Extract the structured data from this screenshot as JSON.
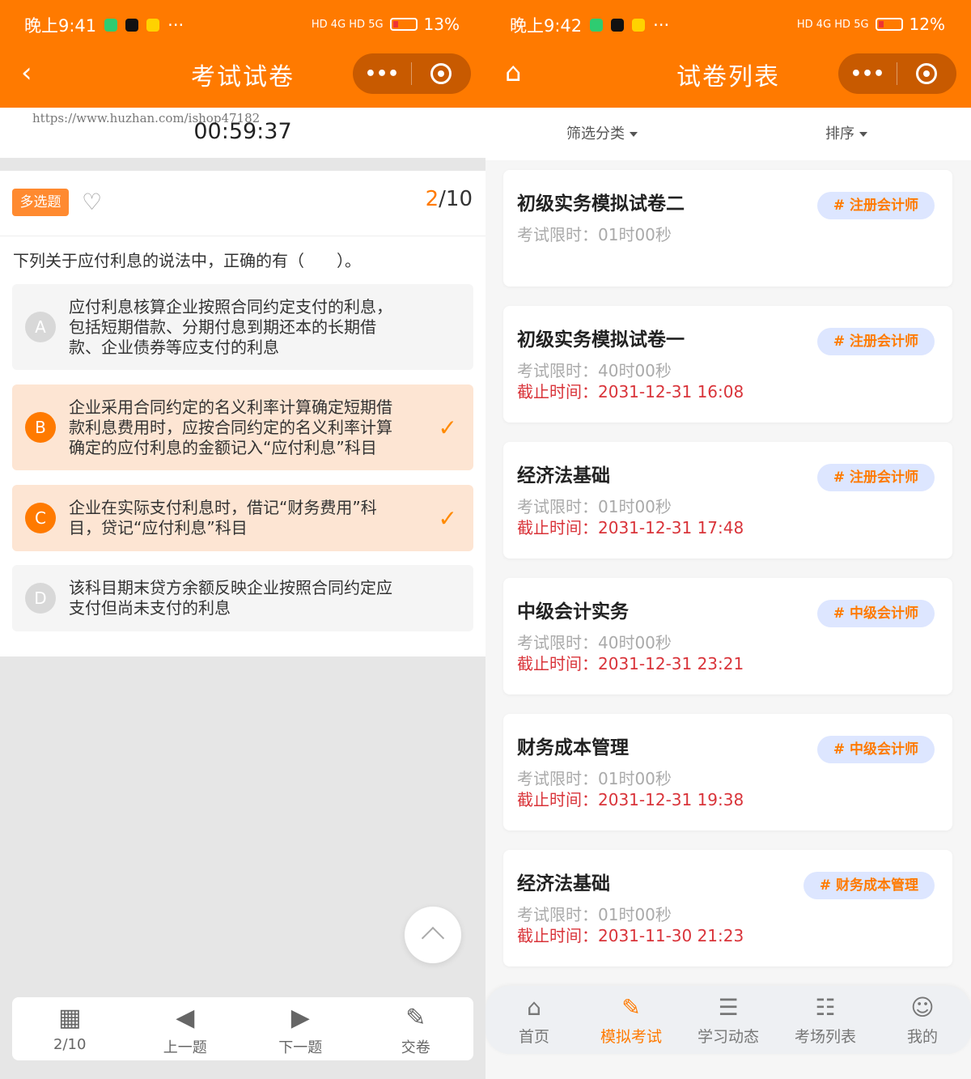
{
  "left": {
    "status": {
      "time": "晚上9:41",
      "signal": "HD 4G HD 5G",
      "battery": "13%"
    },
    "nav": {
      "back_icon": "chevron-left-icon",
      "title": "考试试卷",
      "more_icon": "more-dots-icon",
      "record_icon": "record-icon"
    },
    "watermark": "https://www.huzhan.com/ishop47182",
    "timer": "00:59:37",
    "question": {
      "type_tag": "多选题",
      "progress_current": "2",
      "progress_total": "/10",
      "text": "下列关于应付利息的说法中，正确的有（　　）。",
      "options": [
        {
          "letter": "A",
          "lines": [
            "应付利息核算企业按照合同约定支付的利息，",
            "包括短期借款、分期付息到期还本的长期借",
            "款、企业债券等应支付的利息"
          ],
          "selected": false
        },
        {
          "letter": "B",
          "lines": [
            "企业采用合同约定的名义利率计算确定短期借",
            "款利息费用时，应按合同约定的名义利率计算",
            "确定的应付利息的金额记入“应付利息”科目"
          ],
          "selected": true
        },
        {
          "letter": "C",
          "lines": [
            "企业在实际支付利息时，借记“财务费用”科",
            "目，贷记“应付利息”科目"
          ],
          "selected": true
        },
        {
          "letter": "D",
          "lines": [
            "该科目期末贷方余额反映企业按照合同约定应",
            "支付但尚未支付的利息"
          ],
          "selected": false
        }
      ]
    },
    "bottom": [
      {
        "icon": "grid-icon",
        "label": "2/10"
      },
      {
        "icon": "prev-circle-icon",
        "label": "上一题"
      },
      {
        "icon": "next-circle-icon",
        "label": "下一题"
      },
      {
        "icon": "submit-paper-icon",
        "label": "交卷"
      }
    ]
  },
  "right": {
    "status": {
      "time": "晚上9:42",
      "signal": "HD 4G HD 5G",
      "battery": "12%"
    },
    "nav": {
      "home_icon": "home-icon",
      "title": "试卷列表"
    },
    "filters": {
      "category": "筛选分类",
      "sort": "排序"
    },
    "exams": [
      {
        "title": "初级实务模拟试卷二",
        "tag": "# 注册会计师",
        "limit": "考试限时：01时00秒",
        "deadline": ""
      },
      {
        "title": "初级实务模拟试卷一",
        "tag": "# 注册会计师",
        "limit": "考试限时：40时00秒",
        "deadline": "截止时间：2031-12-31 16:08"
      },
      {
        "title": "经济法基础",
        "tag": "# 注册会计师",
        "limit": "考试限时：01时00秒",
        "deadline": "截止时间：2031-12-31 17:48"
      },
      {
        "title": "中级会计实务",
        "tag": "# 中级会计师",
        "limit": "考试限时：40时00秒",
        "deadline": "截止时间：2031-12-31 23:21"
      },
      {
        "title": "财务成本管理",
        "tag": "# 中级会计师",
        "limit": "考试限时：01时00秒",
        "deadline": "截止时间：2031-12-31 19:38"
      },
      {
        "title": "经济法基础",
        "tag": "# 财务成本管理",
        "limit": "考试限时：01时00秒",
        "deadline": "截止时间：2031-11-30 21:23"
      }
    ],
    "tabs": [
      {
        "icon": "home-icon",
        "label": "首页",
        "active": false
      },
      {
        "icon": "edit-doc-icon",
        "label": "模拟考试",
        "active": true
      },
      {
        "icon": "notes-icon",
        "label": "学习动态",
        "active": false
      },
      {
        "icon": "list-icon",
        "label": "考场列表",
        "active": false
      },
      {
        "icon": "user-icon",
        "label": "我的",
        "active": false
      }
    ]
  },
  "colors": {
    "brand": "#ff7a00",
    "deadline": "#d9343a",
    "tag_bg": "#dde6ff",
    "selected_bg": "#fde5d3"
  }
}
